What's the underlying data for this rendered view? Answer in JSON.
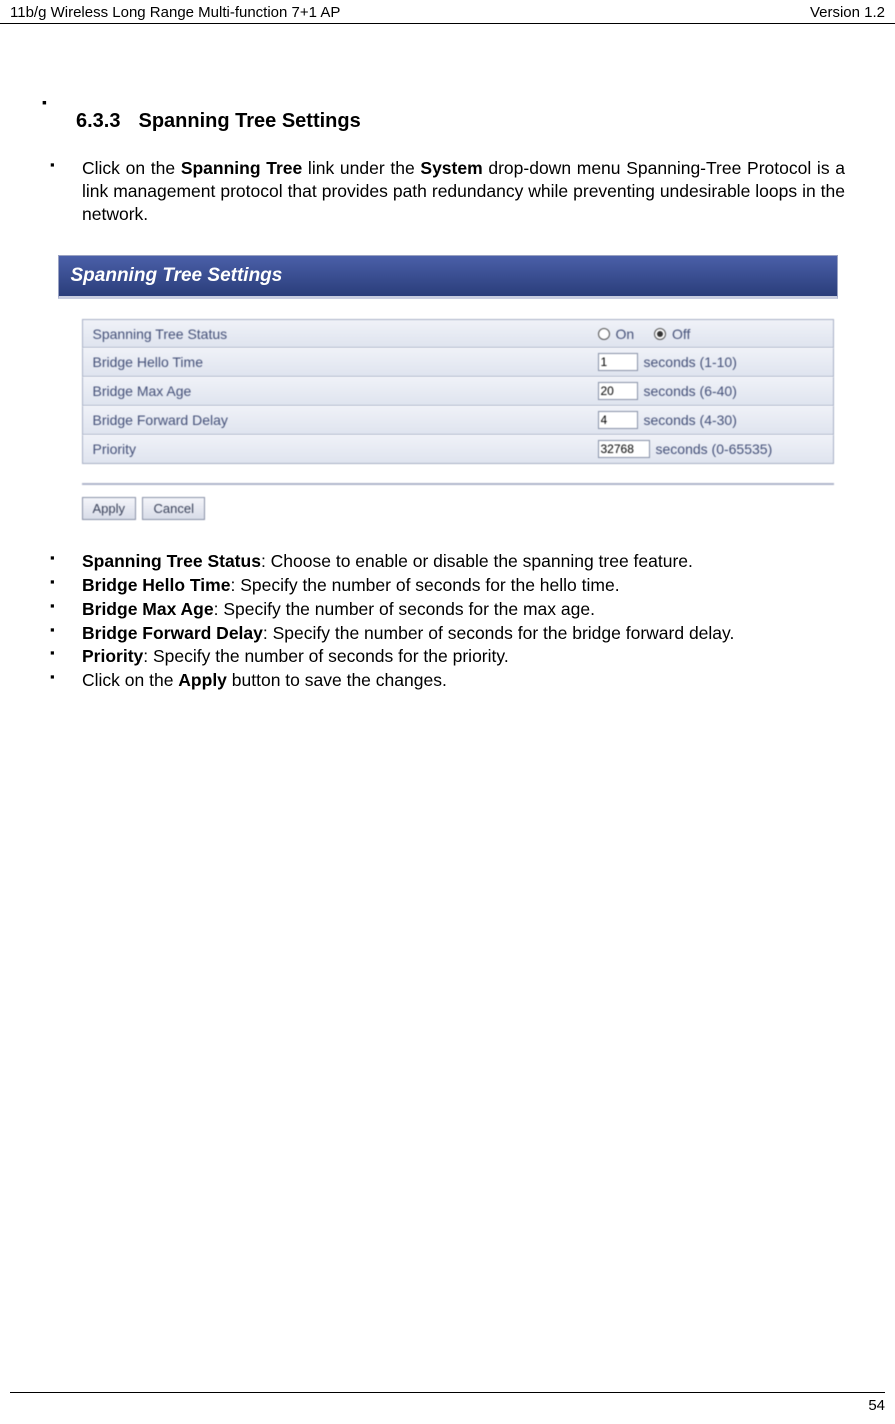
{
  "header": {
    "left": "11b/g Wireless Long Range Multi-function 7+1 AP",
    "right": "Version 1.2"
  },
  "footer": {
    "page": "54"
  },
  "section": {
    "number": "6.3.3",
    "title": "Spanning Tree Settings"
  },
  "intro": {
    "pre": "Click on the ",
    "link": "Spanning Tree",
    "mid": " link under the ",
    "menu": "System",
    "post": " drop-down menu Spanning-Tree Protocol is a link management protocol that provides path redundancy while preventing undesirable loops in the network."
  },
  "panel": {
    "title": "Spanning Tree Settings",
    "rows": {
      "status": {
        "label": "Spanning Tree Status",
        "on": "On",
        "off": "Off",
        "selected": "off"
      },
      "hello": {
        "label": "Bridge Hello Time",
        "value": "1",
        "hint": "seconds (1-10)"
      },
      "maxage": {
        "label": "Bridge Max Age",
        "value": "20",
        "hint": "seconds (6-40)"
      },
      "fwd": {
        "label": "Bridge Forward Delay",
        "value": "4",
        "hint": "seconds (4-30)"
      },
      "prio": {
        "label": "Priority",
        "value": "32768",
        "hint": "seconds (0-65535)"
      }
    },
    "buttons": {
      "apply": "Apply",
      "cancel": "Cancel"
    }
  },
  "descriptions": {
    "status": {
      "b": "Spanning Tree Status",
      "t": ": Choose to enable or disable the spanning tree feature."
    },
    "hello": {
      "b": "Bridge Hello Time",
      "t": ": Specify the number of seconds for the hello time."
    },
    "maxage": {
      "b": "Bridge Max Age",
      "t": ": Specify the number of seconds for the max age."
    },
    "fwd": {
      "b": "Bridge Forward Delay",
      "t": ": Specify the number of seconds for the bridge forward delay."
    },
    "prio": {
      "b": "Priority",
      "t": ": Specify the number of seconds for the priority."
    },
    "apply": {
      "pre": "Click on the ",
      "b": "Apply",
      "t": " button to save the changes."
    }
  }
}
